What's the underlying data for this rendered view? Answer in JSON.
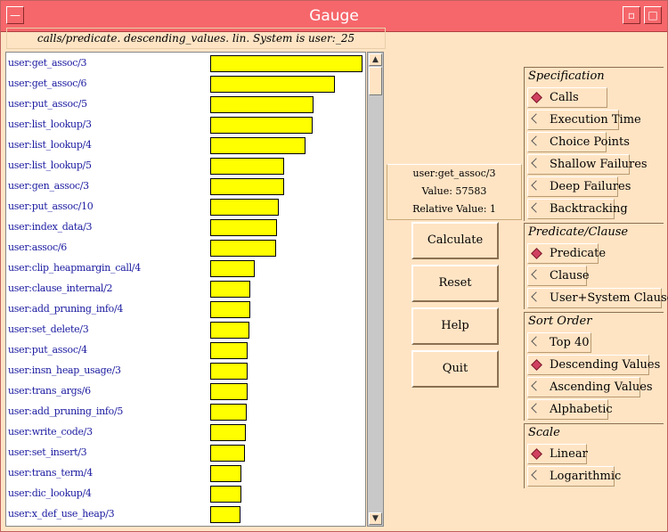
{
  "window": {
    "title": "Gauge",
    "menu_glyph": "—",
    "min_glyph": "▫",
    "max_glyph": "□"
  },
  "header": "calls/predicate. descending_values. lin. System is user:_25",
  "rows": [
    {
      "label": "user:get_assoc/3",
      "value": 57583
    },
    {
      "label": "user:get_assoc/6",
      "value": 47000
    },
    {
      "label": "user:put_assoc/5",
      "value": 39000
    },
    {
      "label": "user:list_lookup/3",
      "value": 38600
    },
    {
      "label": "user:list_lookup/4",
      "value": 36000
    },
    {
      "label": "user:list_lookup/5",
      "value": 28000
    },
    {
      "label": "user:gen_assoc/3",
      "value": 27800
    },
    {
      "label": "user:put_assoc/10",
      "value": 25900
    },
    {
      "label": "user:index_data/3",
      "value": 25300
    },
    {
      "label": "user:assoc/6",
      "value": 24800
    },
    {
      "label": "user:clip_heapmargin_call/4",
      "value": 17000
    },
    {
      "label": "user:clause_internal/2",
      "value": 15200
    },
    {
      "label": "user:add_pruning_info/4",
      "value": 15200
    },
    {
      "label": "user:set_delete/3",
      "value": 14700
    },
    {
      "label": "user:put_assoc/4",
      "value": 14300
    },
    {
      "label": "user:insn_heap_usage/3",
      "value": 14300
    },
    {
      "label": "user:trans_args/6",
      "value": 14300
    },
    {
      "label": "user:add_pruning_info/5",
      "value": 13900
    },
    {
      "label": "user:write_code/3",
      "value": 13400
    },
    {
      "label": "user:set_insert/3",
      "value": 13000
    },
    {
      "label": "user:trans_term/4",
      "value": 11900
    },
    {
      "label": "user:dic_lookup/4",
      "value": 11900
    },
    {
      "label": "user:x_def_use_heap/3",
      "value": 11500
    }
  ],
  "max_value": 57583,
  "info": {
    "name": "user:get_assoc/3",
    "value_line": "Value: 57583",
    "relative_line": "Relative Value: 1"
  },
  "buttons": {
    "calculate": "Calculate",
    "reset": "Reset",
    "help": "Help",
    "quit": "Quit"
  },
  "specification": {
    "title": "Specification",
    "options": [
      {
        "label": "Calls",
        "selected": true
      },
      {
        "label": "Execution Time",
        "selected": false
      },
      {
        "label": "Choice Points",
        "selected": false
      },
      {
        "label": "Shallow Failures",
        "selected": false
      },
      {
        "label": "Deep Failures",
        "selected": false
      },
      {
        "label": "Backtracking",
        "selected": false
      }
    ]
  },
  "predicate_clause": {
    "title": "Predicate/Clause",
    "options": [
      {
        "label": "Predicate",
        "selected": true
      },
      {
        "label": "Clause",
        "selected": false
      },
      {
        "label": "User+System Clauses",
        "selected": false
      }
    ]
  },
  "sort_order": {
    "title": "Sort Order",
    "options": [
      {
        "label": "Top 40",
        "selected": false
      },
      {
        "label": "Descending Values",
        "selected": true
      },
      {
        "label": "Ascending Values",
        "selected": false
      },
      {
        "label": "Alphabetic",
        "selected": false
      }
    ]
  },
  "scale": {
    "title": "Scale",
    "options": [
      {
        "label": "Linear",
        "selected": true
      },
      {
        "label": "Logarithmic",
        "selected": false
      }
    ]
  },
  "scrollbar": {
    "up_glyph": "▲",
    "down_glyph": "▼"
  },
  "colors": {
    "titlebar": "#f5676b",
    "background": "#ffe4c4",
    "bar_fill": "#ffff00",
    "label_text": "#1a1aa0"
  }
}
